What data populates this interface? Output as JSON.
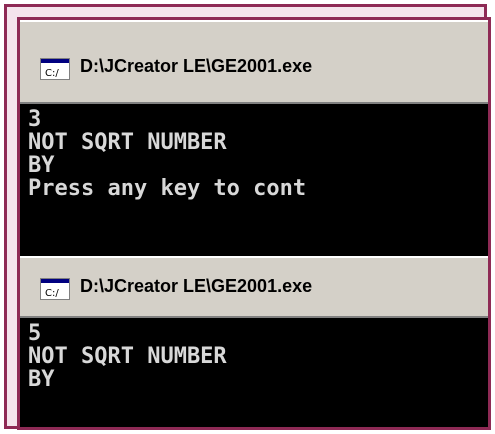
{
  "windows": [
    {
      "title": "D:\\JCreator LE\\GE2001.exe",
      "icon": "console-window-icon",
      "lines": [
        "3",
        "NOT SQRT NUMBER",
        "BY",
        "Press any key to cont"
      ]
    },
    {
      "title": "D:\\JCreator LE\\GE2001.exe",
      "icon": "console-window-icon",
      "lines": [
        "5",
        "NOT SQRT NUMBER",
        "BY"
      ]
    }
  ],
  "colors": {
    "frame": "#8e2a55",
    "titlebar": "#d4d0c8",
    "console_bg": "#000000",
    "console_text": "#d8d8d8"
  }
}
